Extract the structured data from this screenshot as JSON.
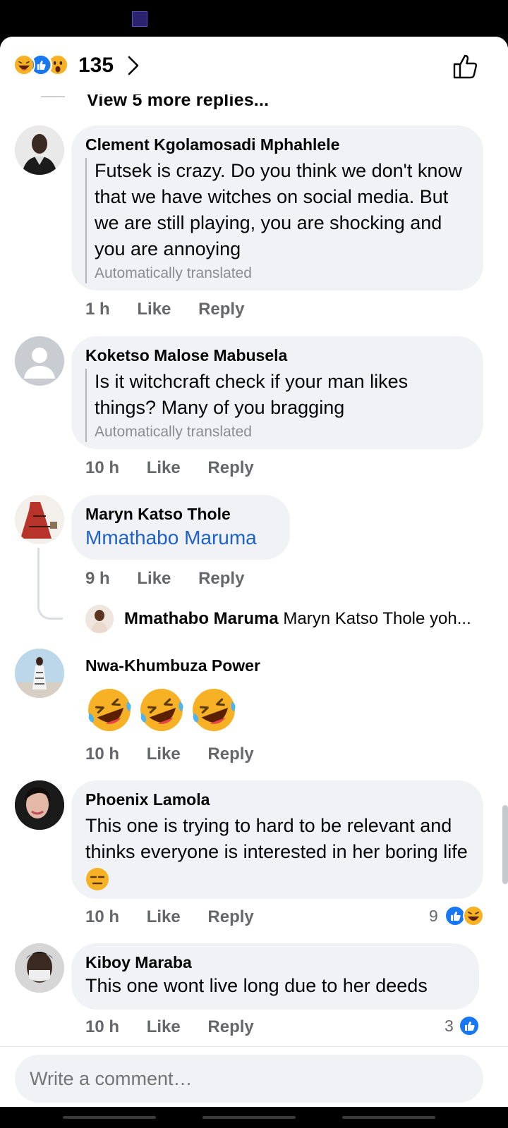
{
  "header": {
    "reaction_count": "135",
    "reactions": [
      "laugh",
      "like",
      "wow"
    ]
  },
  "thread": {
    "view_more": "View 5 more replies..."
  },
  "comments": [
    {
      "author": "Clement Kgolamosadi Mphahlele",
      "text": "Futsek is crazy. Do you think we don't know that we have witches on social media. But we are still playing, you are shocking and you are annoying",
      "translated": "Automatically translated",
      "time": "1 h",
      "like": "Like",
      "reply": "Reply"
    },
    {
      "author": "Koketso Malose Mabusela",
      "text": "Is it witchcraft check if your man likes things? Many of you bragging",
      "translated": "Automatically translated",
      "time": "10 h",
      "like": "Like",
      "reply": "Reply"
    },
    {
      "author": "Maryn Katso Thole",
      "mention": "Mmathabo Maruma",
      "time": "9 h",
      "like": "Like",
      "reply": "Reply",
      "reply_preview": {
        "author": "Mmathabo Maruma",
        "text": "Maryn Katso Thole yoh..."
      }
    },
    {
      "author": "Nwa-Khumbuza Power",
      "emoji": [
        "rolling-laughing",
        "rolling-laughing",
        "rolling-laughing"
      ],
      "time": "10 h",
      "like": "Like",
      "reply": "Reply"
    },
    {
      "author": "Phoenix Lamola",
      "text": "This one is trying to hard to be relevant and thinks everyone is interested in her boring life",
      "emoji": "expressionless",
      "time": "10 h",
      "like": "Like",
      "reply": "Reply",
      "reaction_count": "9"
    },
    {
      "author": "Kiboy Maraba",
      "text": "This one wont live long due to her deeds",
      "time": "10 h",
      "like": "Like",
      "reply": "Reply",
      "reaction_count": "3"
    }
  ],
  "composer": {
    "placeholder": "Write a comment…"
  },
  "colors": {
    "bubble": "#f0f2f5",
    "meta": "#65676b",
    "link": "#1d62c9",
    "like_blue": "#1877f2"
  }
}
